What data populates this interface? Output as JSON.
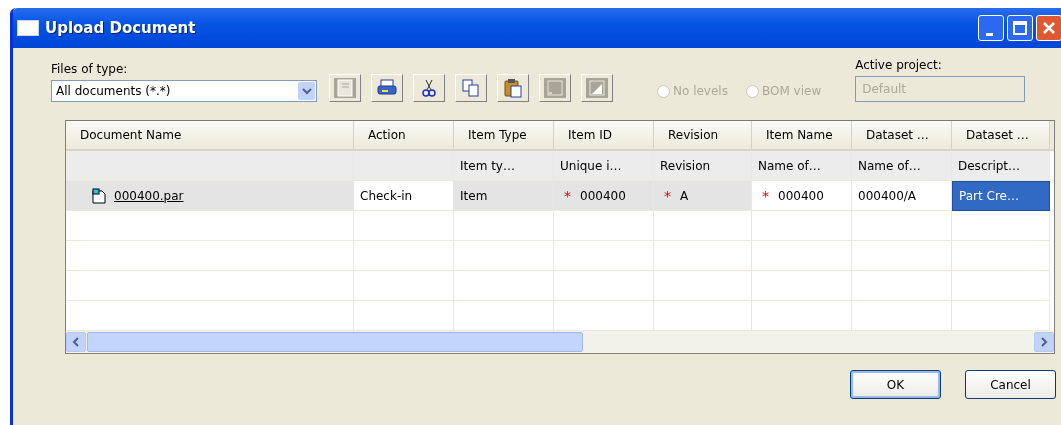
{
  "window": {
    "title": "Upload Document"
  },
  "files_of_type": {
    "label": "Files of type:",
    "value": "All documents (*.*)"
  },
  "toolbar": [
    {
      "kind": "document",
      "disabled": true
    },
    {
      "kind": "print",
      "disabled": false
    },
    {
      "kind": "cut",
      "disabled": false
    },
    {
      "kind": "copy",
      "disabled": false
    },
    {
      "kind": "paste",
      "disabled": false
    },
    {
      "kind": "blank",
      "disabled": true
    },
    {
      "kind": "chart",
      "disabled": true
    }
  ],
  "view_options": [
    {
      "label": "No levels",
      "selected": false,
      "disabled": true
    },
    {
      "label": "BOM view",
      "selected": false,
      "disabled": true
    }
  ],
  "active_project": {
    "label": "Active project:",
    "placeholder": "Default",
    "disabled": true
  },
  "table": {
    "columns": [
      {
        "header": "Document Name"
      },
      {
        "header": "Action"
      },
      {
        "header": "Item Type",
        "description": "Item ty…"
      },
      {
        "header": "Item ID",
        "description": "Unique i…"
      },
      {
        "header": "Revision",
        "description": "Revision"
      },
      {
        "header": "Item Name",
        "description": "Name of…"
      },
      {
        "header": "Dataset …",
        "description": "Name of…"
      },
      {
        "header": "Dataset …",
        "description": "Descript…"
      }
    ],
    "rows": [
      [
        {
          "text": "000400.par",
          "kind": "file",
          "editable": false,
          "selected": false
        },
        {
          "text": "Check-in",
          "kind": "text",
          "editable": true,
          "selected": false
        },
        {
          "text": "Item",
          "kind": "text",
          "editable": false,
          "selected": false
        },
        {
          "text": "000400",
          "kind": "text",
          "required_mark": "*",
          "editable": false,
          "selected": false
        },
        {
          "text": "A",
          "kind": "text",
          "required_mark": "*",
          "editable": false,
          "selected": false
        },
        {
          "text": "000400",
          "kind": "text",
          "required_mark": "*",
          "editable": true,
          "selected": false
        },
        {
          "text": "000400/A",
          "kind": "text",
          "editable": true,
          "selected": false
        },
        {
          "text": "Part Cre…",
          "kind": "text",
          "editable": true,
          "selected": true
        }
      ]
    ]
  },
  "buttons": [
    {
      "label": "OK",
      "default": true
    },
    {
      "label": "Cancel",
      "default": false
    }
  ]
}
